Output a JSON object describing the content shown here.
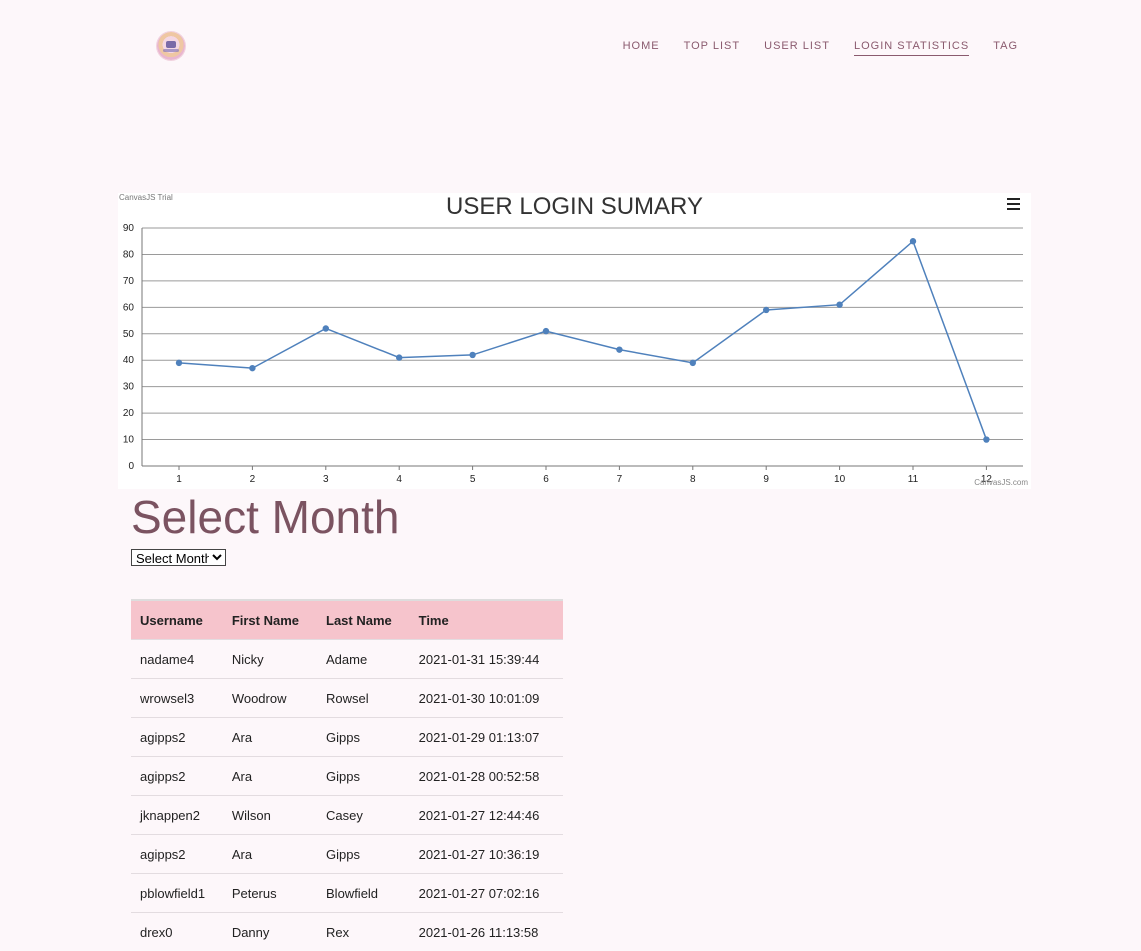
{
  "nav": {
    "items": [
      {
        "label": "HOME"
      },
      {
        "label": "TOP LIST"
      },
      {
        "label": "USER LIST"
      },
      {
        "label": "LOGIN STATISTICS",
        "active": true
      },
      {
        "label": "TAG"
      }
    ]
  },
  "chart": {
    "watermark": "CanvasJS Trial",
    "credit": "CanvasJS.com"
  },
  "chart_data": {
    "type": "line",
    "title": "USER LOGIN SUMARY",
    "x": [
      1,
      2,
      3,
      4,
      5,
      6,
      7,
      8,
      9,
      10,
      11,
      12
    ],
    "series": [
      {
        "values": [
          39,
          37,
          52,
          41,
          42,
          51,
          44,
          39,
          59,
          61,
          85,
          10
        ],
        "color": "#4f81bc"
      }
    ],
    "ylim": [
      0,
      90
    ],
    "yticks": [
      0,
      10,
      20,
      30,
      40,
      50,
      60,
      70,
      80,
      90
    ],
    "grid": true,
    "xlabel": "",
    "ylabel": ""
  },
  "section": {
    "title": "Select Month",
    "select_value": "Select Month"
  },
  "table": {
    "columns": [
      "Username",
      "First Name",
      "Last Name",
      "Time"
    ],
    "rows": [
      [
        "nadame4",
        "Nicky",
        "Adame",
        "2021-01-31 15:39:44"
      ],
      [
        "wrowsel3",
        "Woodrow",
        "Rowsel",
        "2021-01-30 10:01:09"
      ],
      [
        "agipps2",
        "Ara",
        "Gipps",
        "2021-01-29 01:13:07"
      ],
      [
        "agipps2",
        "Ara",
        "Gipps",
        "2021-01-28 00:52:58"
      ],
      [
        "jknappen2",
        "Wilson",
        "Casey",
        "2021-01-27 12:44:46"
      ],
      [
        "agipps2",
        "Ara",
        "Gipps",
        "2021-01-27 10:36:19"
      ],
      [
        "pblowfield1",
        "Peterus",
        "Blowfield",
        "2021-01-27 07:02:16"
      ],
      [
        "drex0",
        "Danny",
        "Rex",
        "2021-01-26 11:13:58"
      ]
    ]
  }
}
